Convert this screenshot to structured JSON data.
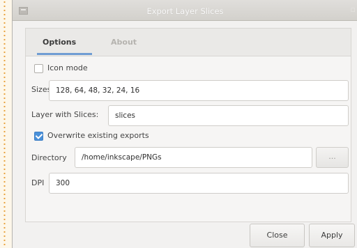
{
  "window": {
    "title": "Export Layer Slices"
  },
  "tabs": [
    {
      "label": "Options",
      "active": true
    },
    {
      "label": "About",
      "active": false
    }
  ],
  "form": {
    "icon_mode": {
      "label": "Icon mode",
      "checked": false
    },
    "sizes": {
      "label": "Sizes",
      "value": "128, 64, 48, 32, 24, 16"
    },
    "layer": {
      "label": "Layer with Slices:",
      "value": "slices"
    },
    "overwrite": {
      "label": "Overwrite existing exports",
      "checked": true
    },
    "directory": {
      "label": "Directory",
      "value": "/home/inkscape/PNGs",
      "browse_label": "..."
    },
    "dpi": {
      "label": "DPI",
      "value": "300"
    }
  },
  "buttons": {
    "close": "Close",
    "apply": "Apply"
  },
  "colors": {
    "accent": "#4a90d9",
    "tab_underline": "#6f9cd3"
  }
}
